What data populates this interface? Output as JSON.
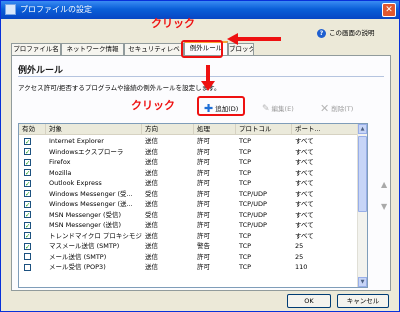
{
  "window": {
    "title": "プロファイルの設定",
    "close_label": "✕"
  },
  "help": {
    "label": "この画面の説明"
  },
  "tabs": [
    {
      "label": "プロファイル名"
    },
    {
      "label": "ネットワーク情報"
    },
    {
      "label": "セキュリティレベ"
    },
    {
      "label": "例外ルール"
    },
    {
      "label": "ブロック"
    }
  ],
  "section": {
    "title": "例外ルール",
    "description": "アクセス許可/拒否するプログラムや接続の例外ルールを設定します。"
  },
  "toolbar": {
    "add_label": "追加(D)",
    "edit_label": "編集(E)",
    "delete_label": "削除(T)"
  },
  "table": {
    "columns": [
      "有効",
      "対象",
      "方向",
      "処理",
      "プロトコル",
      "ポート..."
    ],
    "rows": [
      {
        "enabled": true,
        "target": "Internet Explorer",
        "direction": "送信",
        "action": "許可",
        "protocol": "TCP",
        "port": "すべて"
      },
      {
        "enabled": true,
        "target": "Windowsエクスプローラ",
        "direction": "送信",
        "action": "許可",
        "protocol": "TCP",
        "port": "すべて"
      },
      {
        "enabled": true,
        "target": "Firefox",
        "direction": "送信",
        "action": "許可",
        "protocol": "TCP",
        "port": "すべて"
      },
      {
        "enabled": true,
        "target": "Mozilla",
        "direction": "送信",
        "action": "許可",
        "protocol": "TCP",
        "port": "すべて"
      },
      {
        "enabled": true,
        "target": "Outlook Express",
        "direction": "送信",
        "action": "許可",
        "protocol": "TCP",
        "port": "すべて"
      },
      {
        "enabled": true,
        "target": "Windows Messenger (受...",
        "direction": "受信",
        "action": "許可",
        "protocol": "TCP/UDP",
        "port": "すべて"
      },
      {
        "enabled": true,
        "target": "Windows Messenger (送...",
        "direction": "送信",
        "action": "許可",
        "protocol": "TCP/UDP",
        "port": "すべて"
      },
      {
        "enabled": true,
        "target": "MSN Messenger (受信)",
        "direction": "受信",
        "action": "許可",
        "protocol": "TCP/UDP",
        "port": "すべて"
      },
      {
        "enabled": true,
        "target": "MSN Messenger (送信)",
        "direction": "送信",
        "action": "許可",
        "protocol": "TCP/UDP",
        "port": "すべて"
      },
      {
        "enabled": true,
        "target": "トレンドマイクロ プロキシモジ...",
        "direction": "送信",
        "action": "許可",
        "protocol": "TCP",
        "port": "すべて"
      },
      {
        "enabled": true,
        "target": "マスメール送信 (SMTP)",
        "direction": "送信",
        "action": "警告",
        "protocol": "TCP",
        "port": "25"
      },
      {
        "enabled": false,
        "target": "メール送信 (SMTP)",
        "direction": "送信",
        "action": "許可",
        "protocol": "TCP",
        "port": "25"
      },
      {
        "enabled": false,
        "target": "メール受信 (POP3)",
        "direction": "送信",
        "action": "許可",
        "protocol": "TCP",
        "port": "110"
      }
    ]
  },
  "side_buttons": {
    "up_icon": "▲",
    "down_icon": "▼"
  },
  "footer": {
    "ok_label": "OK",
    "cancel_label": "キャンセル"
  },
  "annotations": {
    "click_top": "クリック",
    "click_add": "クリック"
  },
  "colors": {
    "title_bar": "#0a5fd8",
    "annotation": "#ee1111",
    "check": "#21a121"
  }
}
